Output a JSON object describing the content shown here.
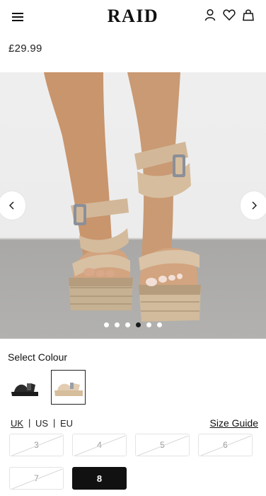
{
  "header": {
    "logo": "RAID",
    "icons": [
      "menu-icon",
      "account-icon",
      "wishlist-heart-icon",
      "bag-icon"
    ]
  },
  "product": {
    "price": "£29.99"
  },
  "gallery": {
    "slide_count": 6,
    "active_slide": 4
  },
  "colour": {
    "label": "Select Colour",
    "swatches": [
      {
        "name": "Black",
        "color": "#1c1c1c",
        "selected": false
      },
      {
        "name": "Natural",
        "color": "#dcc3a4",
        "selected": true
      }
    ]
  },
  "sizes": {
    "systems": [
      "UK",
      "US",
      "EU"
    ],
    "separator": "|",
    "active_system": "UK",
    "guide_label": "Size Guide",
    "options": [
      {
        "label": "3",
        "available": false
      },
      {
        "label": "4",
        "available": false
      },
      {
        "label": "5",
        "available": false
      },
      {
        "label": "6",
        "available": false
      },
      {
        "label": "7",
        "available": false
      },
      {
        "label": "8",
        "available": true,
        "selected": true
      }
    ]
  }
}
